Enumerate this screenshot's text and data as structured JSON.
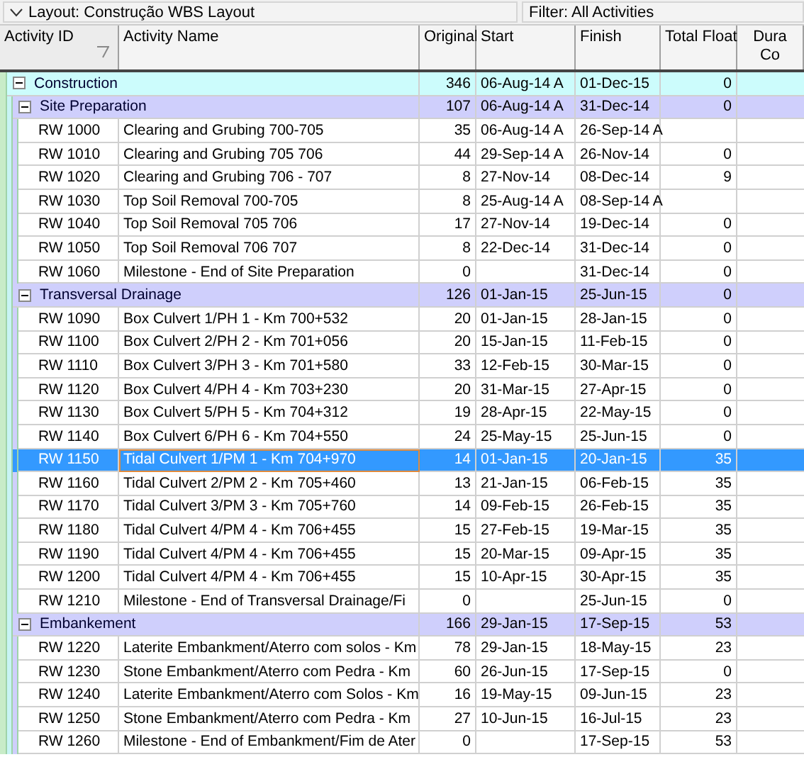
{
  "layout_bar": {
    "layout": "Layout: Construção WBS Layout",
    "filter": "Filter: All Activities",
    "expanded": true
  },
  "columns": [
    {
      "label": "Activity ID",
      "sorted": true
    },
    {
      "label": "Activity Name",
      "sorted": false
    },
    {
      "label": "Original",
      "sorted": false
    },
    {
      "label": "Start",
      "sorted": false
    },
    {
      "label": "Finish",
      "sorted": false
    },
    {
      "label": "Total Float",
      "sorted": false
    },
    {
      "label": "Dura",
      "label_line_2": "Co",
      "sorted": false
    }
  ],
  "wbs": {
    "name": "Construction",
    "original": "346",
    "start": "06-Aug-14 A",
    "finish": "01-Dec-15",
    "total_float": "0",
    "expanded": true,
    "children": [
      {
        "name": "Site Preparation",
        "original": "107",
        "start": "06-Aug-14 A",
        "finish": "31-Dec-14",
        "total_float": "0",
        "expanded": true,
        "activities": [
          {
            "id": "RW 1000",
            "name": "Clearing and Grubing 700-705",
            "original": "35",
            "start": "06-Aug-14 A",
            "finish": "26-Sep-14 A",
            "selected": false
          },
          {
            "id": "RW 1010",
            "name": "Clearing and Grubing 705 706",
            "original": "44",
            "start": "29-Sep-14 A",
            "finish": "26-Nov-14",
            "total_float": "0",
            "selected": false
          },
          {
            "id": "RW 1020",
            "name": "Clearing and Grubing 706 - 707",
            "original": "8",
            "start": "27-Nov-14",
            "finish": "08-Dec-14",
            "total_float": "9",
            "selected": false
          },
          {
            "id": "RW 1030",
            "name": "Top Soil Removal 700-705",
            "original": "8",
            "start": "25-Aug-14 A",
            "finish": "08-Sep-14 A",
            "selected": false
          },
          {
            "id": "RW 1040",
            "name": "Top Soil Removal 705 706",
            "original": "17",
            "start": "27-Nov-14",
            "finish": "19-Dec-14",
            "total_float": "0",
            "selected": false
          },
          {
            "id": "RW 1050",
            "name": "Top Soil Removal 706 707",
            "original": "8",
            "start": "22-Dec-14",
            "finish": "31-Dec-14",
            "total_float": "0",
            "selected": false
          },
          {
            "id": "RW 1060",
            "name": "Milestone - End of Site Preparation",
            "original": "0",
            "finish": "31-Dec-14",
            "total_float": "0",
            "selected": false
          }
        ]
      },
      {
        "name": "Transversal Drainage",
        "original": "126",
        "start": "01-Jan-15",
        "finish": "25-Jun-15",
        "total_float": "0",
        "expanded": true,
        "activities": [
          {
            "id": "RW 1090",
            "name": "Box Culvert 1/PH 1 - Km 700+532",
            "original": "20",
            "start": "01-Jan-15",
            "finish": "28-Jan-15",
            "total_float": "0",
            "selected": false
          },
          {
            "id": "RW 1100",
            "name": "Box Culvert 2/PH 2 - Km 701+056",
            "original": "20",
            "start": "15-Jan-15",
            "finish": "11-Feb-15",
            "total_float": "0",
            "selected": false
          },
          {
            "id": "RW 1110",
            "name": "Box Culvert 3/PH 3 - Km 701+580",
            "original": "33",
            "start": "12-Feb-15",
            "finish": "30-Mar-15",
            "total_float": "0",
            "selected": false
          },
          {
            "id": "RW 1120",
            "name": "Box Culvert 4/PH 4 - Km 703+230",
            "original": "20",
            "start": "31-Mar-15",
            "finish": "27-Apr-15",
            "total_float": "0",
            "selected": false
          },
          {
            "id": "RW 1130",
            "name": "Box Culvert 5/PH 5 - Km 704+312",
            "original": "19",
            "start": "28-Apr-15",
            "finish": "22-May-15",
            "total_float": "0",
            "selected": false
          },
          {
            "id": "RW 1140",
            "name": "Box Culvert 6/PH 6 - Km 704+550",
            "original": "24",
            "start": "25-May-15",
            "finish": "25-Jun-15",
            "total_float": "0",
            "selected": false
          },
          {
            "id": "RW 1150",
            "name": "Tidal Culvert 1/PM 1 - Km 704+970",
            "original": "14",
            "start": "01-Jan-15",
            "finish": "20-Jan-15",
            "total_float": "35",
            "selected": true
          },
          {
            "id": "RW 1160",
            "name": "Tidal Culvert 2/PM 2 - Km 705+460",
            "original": "13",
            "start": "21-Jan-15",
            "finish": "06-Feb-15",
            "total_float": "35",
            "selected": false
          },
          {
            "id": "RW 1170",
            "name": "Tidal Culvert 3/PM 3 - Km 705+760",
            "original": "14",
            "start": "09-Feb-15",
            "finish": "26-Feb-15",
            "total_float": "35",
            "selected": false
          },
          {
            "id": "RW 1180",
            "name": "Tidal Culvert 4/PM 4 - Km 706+455",
            "original": "15",
            "start": "27-Feb-15",
            "finish": "19-Mar-15",
            "total_float": "35",
            "selected": false
          },
          {
            "id": "RW 1190",
            "name": "Tidal Culvert 4/PM 4 - Km 706+455",
            "original": "15",
            "start": "20-Mar-15",
            "finish": "09-Apr-15",
            "total_float": "35",
            "selected": false
          },
          {
            "id": "RW 1200",
            "name": "Tidal Culvert 4/PM 4 - Km 706+455",
            "original": "15",
            "start": "10-Apr-15",
            "finish": "30-Apr-15",
            "total_float": "35",
            "selected": false
          },
          {
            "id": "RW 1210",
            "name": "Milestone - End of Transversal Drainage/Fi",
            "original": "0",
            "finish": "25-Jun-15",
            "total_float": "0",
            "selected": false
          }
        ]
      },
      {
        "name": "Embankement",
        "original": "166",
        "start": "29-Jan-15",
        "finish": "17-Sep-15",
        "total_float": "53",
        "expanded": true,
        "activities": [
          {
            "id": "RW 1220",
            "name": "Laterite Embankment/Aterro com solos - Km",
            "original": "78",
            "start": "29-Jan-15",
            "finish": "18-May-15",
            "total_float": "23",
            "selected": false
          },
          {
            "id": "RW 1230",
            "name": "Stone Embankment/Aterro com Pedra - Km",
            "original": "60",
            "start": "26-Jun-15",
            "finish": "17-Sep-15",
            "total_float": "0",
            "selected": false
          },
          {
            "id": "RW 1240",
            "name": "Laterite Embankment/Aterro com Solos - Km",
            "original": "16",
            "start": "19-May-15",
            "finish": "09-Jun-15",
            "total_float": "23",
            "selected": false
          },
          {
            "id": "RW 1250",
            "name": "Stone Embankment/Aterro com Pedra - Km",
            "original": "27",
            "start": "10-Jun-15",
            "finish": "16-Jul-15",
            "total_float": "23",
            "selected": false
          },
          {
            "id": "RW 1260",
            "name": "Milestone - End of Embankment/Fim de Ater",
            "original": "0",
            "finish": "17-Sep-15",
            "total_float": "53",
            "selected": false
          }
        ]
      }
    ]
  }
}
